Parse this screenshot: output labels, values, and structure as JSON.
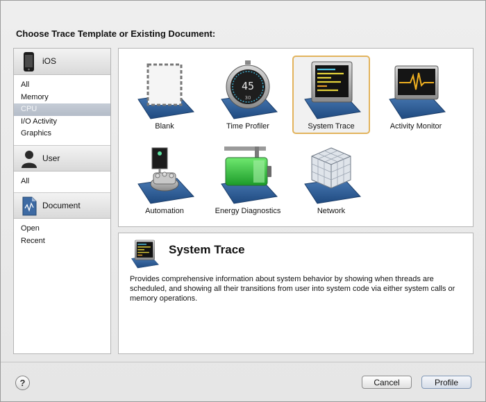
{
  "dialog": {
    "title": "Choose Trace Template or Existing Document:"
  },
  "sidebar": {
    "sections": [
      {
        "header": "iOS",
        "icon": "iphone-icon",
        "items": [
          "All",
          "Memory",
          "CPU",
          "I/O Activity",
          "Graphics"
        ],
        "selected": "CPU"
      },
      {
        "header": "User",
        "icon": "user-silhouette-icon",
        "items": [
          "All"
        ]
      },
      {
        "header": "Document",
        "icon": "trace-document-icon",
        "items": [
          "Open",
          "Recent"
        ]
      }
    ]
  },
  "templates": [
    {
      "label": "Blank",
      "icon": "blank-template-icon"
    },
    {
      "label": "Time Profiler",
      "icon": "stopwatch-icon",
      "stopwatch_text": "45",
      "stopwatch_sub": "30"
    },
    {
      "label": "System Trace",
      "icon": "system-trace-icon",
      "selected": true
    },
    {
      "label": "Activity Monitor",
      "icon": "activity-monitor-icon"
    },
    {
      "label": "Automation",
      "icon": "automation-robot-icon"
    },
    {
      "label": "Energy Diagnostics",
      "icon": "battery-icon"
    },
    {
      "label": "Network",
      "icon": "network-cube-icon"
    }
  ],
  "description": {
    "title": "System Trace",
    "text": "Provides comprehensive information about system behavior by showing when threads are scheduled, and showing all their transitions from user into system code via either system calls or memory operations."
  },
  "footer": {
    "help": "?",
    "cancel_label": "Cancel",
    "profile_label": "Profile"
  },
  "colors": {
    "selection_border": "#e2b35c",
    "platform_blue": "#2f5e97",
    "sidebar_selection": "#b9c1cd"
  }
}
